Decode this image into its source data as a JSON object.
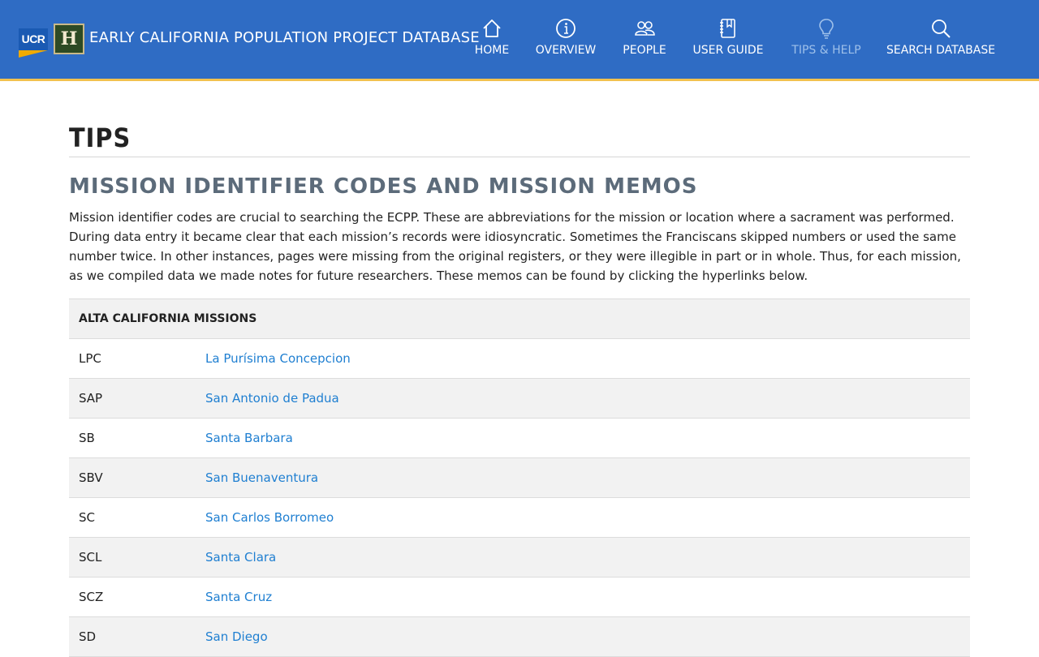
{
  "header": {
    "ucr_logo_text": "UCR",
    "h_logo_text": "H",
    "site_title": "EARLY CALIFORNIA POPULATION PROJECT DATABASE",
    "colors": {
      "background": "#2f6cc4",
      "accent_rule": "#f2c14e",
      "dim_item": "#9ec0ea"
    },
    "nav": [
      {
        "label": "HOME",
        "icon": "home-icon"
      },
      {
        "label": "OVERVIEW",
        "icon": "info-icon"
      },
      {
        "label": "PEOPLE",
        "icon": "people-icon"
      },
      {
        "label": "USER GUIDE",
        "icon": "guide-book-icon"
      },
      {
        "label": "TIPS & HELP",
        "icon": "lightbulb-icon",
        "active": true
      },
      {
        "label": "SEARCH DATABASE",
        "icon": "search-icon"
      }
    ]
  },
  "main": {
    "page_title": "TIPS",
    "section_title": "MISSION IDENTIFIER CODES AND MISSION MEMOS",
    "intro": "Mission identifier codes are crucial to searching the ECPP. These are abbreviations for the mission or location where a sacrament was performed. During data entry it became clear that each mission’s records were idiosyncratic. Sometimes the Franciscans skipped numbers or used the same number twice. In other instances, pages were missing from the original registers, or they were illegible in part or in whole. Thus, for each mission, as we compiled data we made notes for future researchers. These memos can be found by clicking the hyperlinks below.",
    "table": {
      "header": "ALTA CALIFORNIA MISSIONS",
      "rows": [
        {
          "code": "LPC",
          "name": "La Purísima Concepcion"
        },
        {
          "code": "SAP",
          "name": "San Antonio de Padua"
        },
        {
          "code": "SB",
          "name": "Santa Barbara"
        },
        {
          "code": "SBV",
          "name": "San Buenaventura"
        },
        {
          "code": "SC",
          "name": "San Carlos Borromeo"
        },
        {
          "code": "SCL",
          "name": "Santa Clara"
        },
        {
          "code": "SCZ",
          "name": "Santa Cruz"
        },
        {
          "code": "SD",
          "name": "San Diego"
        }
      ]
    },
    "link_color": "#1f7fd1"
  }
}
